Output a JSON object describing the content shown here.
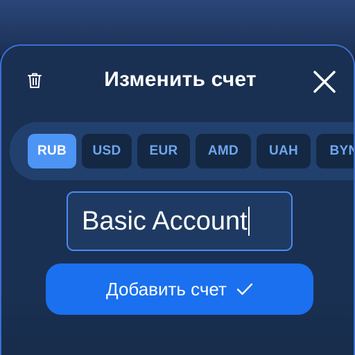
{
  "dialog": {
    "title": "Изменить счет",
    "trash_icon": "trash-icon",
    "close_icon": "close-icon"
  },
  "currencies": {
    "selected": "RUB",
    "items": [
      "RUB",
      "USD",
      "EUR",
      "AMD",
      "UAH",
      "BYN"
    ]
  },
  "account_name": {
    "value": "Basic Account"
  },
  "submit": {
    "label": "Добавить счет",
    "icon": "check-icon"
  },
  "colors": {
    "accent": "#1a70ee",
    "chip_active": "#4d95f5",
    "sheet_background": "#193052"
  }
}
